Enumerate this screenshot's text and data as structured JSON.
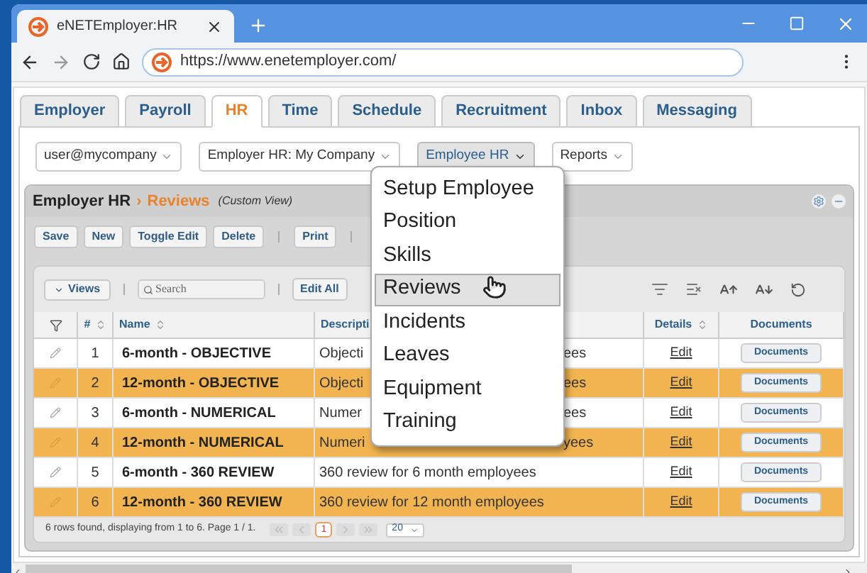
{
  "browser": {
    "tab_title": "eNETEmployer:HR",
    "url": "https://www.enetemployer.com/"
  },
  "nav_tabs": [
    {
      "label": "Employer",
      "selected": false
    },
    {
      "label": "Payroll",
      "selected": false
    },
    {
      "label": "HR",
      "selected": true
    },
    {
      "label": "Time",
      "selected": false
    },
    {
      "label": "Schedule",
      "selected": false
    },
    {
      "label": "Recruitment",
      "selected": false
    },
    {
      "label": "Inbox",
      "selected": false
    },
    {
      "label": "Messaging",
      "selected": false
    }
  ],
  "selectors": [
    {
      "label": "user@mycompany",
      "selected": false
    },
    {
      "label": "Employer HR: My Company",
      "selected": false
    },
    {
      "label": "Employee HR",
      "selected": true
    },
    {
      "label": "Reports",
      "selected": false
    }
  ],
  "panel": {
    "title": "Employer HR",
    "separator": "›",
    "section": "Reviews",
    "view": "(Custom View)"
  },
  "toolbar_buttons": [
    "Save",
    "New",
    "Toggle Edit",
    "Delete",
    "Print"
  ],
  "grid_toolbar": {
    "views": "Views",
    "search_placeholder": "Search",
    "edit_all": "Edit All"
  },
  "table": {
    "columns": [
      {
        "label": "#",
        "sortable": true
      },
      {
        "label": "Name",
        "sortable": true
      },
      {
        "label": "Descripti",
        "sortable": false
      },
      {
        "label": "Details",
        "sortable": true
      },
      {
        "label": "Documents",
        "sortable": false
      }
    ],
    "rows": [
      {
        "number": "1",
        "name": "6-month - OBJECTIVE",
        "description": [
          "Objecti",
          "ees"
        ],
        "details": "Edit",
        "documents": "Documents",
        "shaded": false
      },
      {
        "number": "2",
        "name": "12-month - OBJECTIVE",
        "description": [
          "Objecti",
          "ees"
        ],
        "details": "Edit",
        "documents": "Documents",
        "shaded": true
      },
      {
        "number": "3",
        "name": "6-month - NUMERICAL",
        "description": [
          "Numer",
          "ees"
        ],
        "details": "Edit",
        "documents": "Documents",
        "shaded": false
      },
      {
        "number": "4",
        "name": "12-month - NUMERICAL",
        "description": [
          "Numeri",
          "yees"
        ],
        "details": "Edit",
        "documents": "Documents",
        "shaded": true
      },
      {
        "number": "5",
        "name": "6-month - 360 REVIEW",
        "description": [
          "360 review for 6 month employees"
        ],
        "details": "Edit",
        "documents": "Documents",
        "shaded": false
      },
      {
        "number": "6",
        "name": "12-month - 360 REVIEW",
        "description": [
          "360 review for 12 month employees"
        ],
        "details": "Edit",
        "documents": "Documents",
        "shaded": true
      }
    ]
  },
  "footer": {
    "status": "6 rows found, displaying from 1 to 6. Page 1 / 1.",
    "page": "1",
    "page_size": "20"
  },
  "menu": {
    "items": [
      {
        "label": "Setup Employee",
        "selected": false
      },
      {
        "label": "Position",
        "selected": false
      },
      {
        "label": "Skills",
        "selected": false
      },
      {
        "label": "Reviews",
        "selected": true
      },
      {
        "label": "Incidents",
        "selected": false
      },
      {
        "label": "Leaves",
        "selected": false
      },
      {
        "label": "Equipment",
        "selected": false
      },
      {
        "label": "Training",
        "selected": false
      }
    ]
  }
}
